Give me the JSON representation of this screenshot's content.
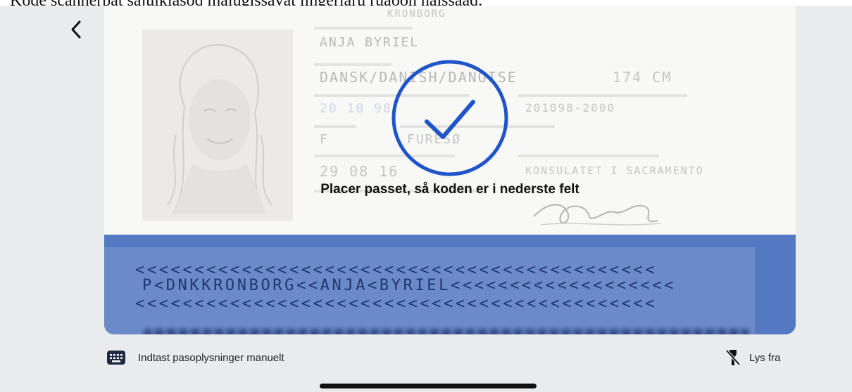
{
  "caption": "Kode scannerpat sajuiklasoq malugissavat iingerlaru ruaoon naissaaq.",
  "nav": {
    "back_icon": "chevron-left-icon"
  },
  "passport": {
    "surname": "KRONBORG",
    "given_names": "ANJA BYRIEL",
    "nationality": "DANSK/DANISH/DANOISE",
    "height": "174 CM",
    "birth_date": "20 10 98",
    "personal_no": "201098-2000",
    "sex": "F",
    "birthplace": "FURESØ",
    "issue_date": "29 08 16",
    "authority": "KONSULATET I SACRAMENTO"
  },
  "mrz": {
    "line1": "<<<<<<<<<<<<<<<<<<<<<<<<<<<<<<<<<<<<<<<<<<<<",
    "line2": "P<DNKKRONBORG<<ANJA<BYRIEL<<<<<<<<<<<<<<<<<<<",
    "line3": "<<<<<<<<<<<<<<<<<<<<<<<<<<<<<<<<<<<<<<<<<<<<"
  },
  "scan": {
    "status_icon": "checkmark-circle-icon",
    "instruction": "Placer passet, så koden er i nederste felt"
  },
  "footer": {
    "manual_icon": "keyboard-icon",
    "manual_label": "Indtast pasoplysninger manuelt",
    "light_icon": "flashlight-off-icon",
    "light_label": "Lys fra"
  },
  "colors": {
    "accent": "#1f55c8",
    "mrz_band": "#5479c2",
    "background": "#e9ebed"
  }
}
